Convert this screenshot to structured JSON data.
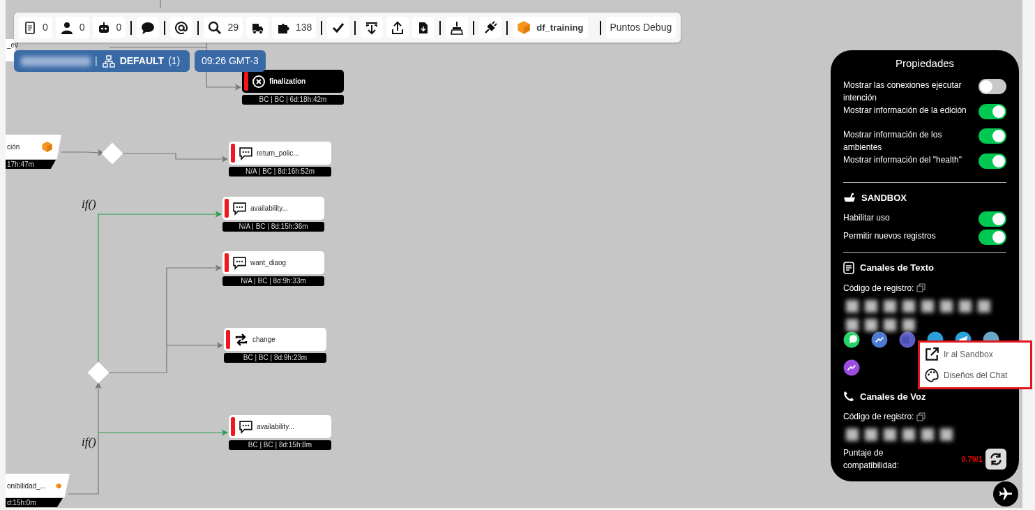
{
  "toolbar": {
    "counts": [
      "0",
      "0",
      "0",
      "29",
      "138"
    ],
    "project": "df_training",
    "debug_button": "Puntos Debug"
  },
  "badges": {
    "separator": "|",
    "environment": "DEFAULT",
    "environment_count": "(1)",
    "time": "09:26 GMT-3"
  },
  "canvas": {
    "partial_nodes": [
      {
        "label": "_ev"
      },
      {
        "label": "ción",
        "info": "17h:47m"
      },
      {
        "label": "onibilidad_...",
        "info": "d:15h:0m"
      }
    ],
    "nodes": [
      {
        "kind": "end",
        "label": "finalization",
        "info": "BC | BC | 6d:18h:42m"
      },
      {
        "kind": "message",
        "label": "return_polic...",
        "info": "N/A | BC | 8d:16h:52m"
      },
      {
        "kind": "message",
        "label": "availability...",
        "info": "N/A | BC | 8d:15h:36m"
      },
      {
        "kind": "message",
        "label": "want_diaog",
        "info": "N/A | BC | 8d:9h:33m"
      },
      {
        "kind": "action",
        "label": "change",
        "info": "BC | BC | 8d:9h:23m"
      },
      {
        "kind": "message",
        "label": "availability...",
        "info": "BC | BC | 8d:15h:8m"
      }
    ],
    "conditions": [
      "if()",
      "if()"
    ]
  },
  "properties": {
    "title": "Propiedades",
    "toggles": [
      {
        "label": "Mostrar las conexiones ejecutar intención",
        "on": false
      },
      {
        "label": "Mostrar información de la edición",
        "on": true
      },
      {
        "label": "Mostrar información de los ambientes",
        "on": true
      },
      {
        "label": "Mostrar información del \"health\"",
        "on": true
      }
    ],
    "sandbox": {
      "title": "SANDBOX",
      "toggles": [
        {
          "label": "Habilitar uso",
          "on": true
        },
        {
          "label": "Permitir nuevos registros",
          "on": true
        }
      ]
    },
    "text_channels": {
      "title": "Canales de Texto",
      "code_label": "Código de registro:"
    },
    "voice_channels": {
      "title": "Canales de Voz",
      "code_label": "Código de registro:"
    },
    "compatibility": {
      "label": "Puntaje de compatibilidad:",
      "score": "0.79/1"
    }
  },
  "context_menu": {
    "items": [
      {
        "label": "Ir al Sandbox"
      },
      {
        "label": "Diseños del Chat"
      }
    ]
  }
}
